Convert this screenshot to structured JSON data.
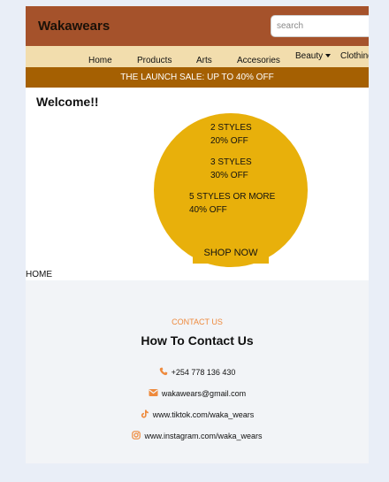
{
  "header": {
    "brand": "Wakawears",
    "search_placeholder": "search"
  },
  "nav": {
    "items": [
      "Home",
      "Products",
      "Arts",
      "Accesories"
    ],
    "dropdown_label": "Beauty",
    "last_label": "Clothing"
  },
  "banner": {
    "text": "THE LAUNCH SALE: UP TO 40% OFF"
  },
  "promo": {
    "welcome": "Welcome!!",
    "offers": [
      {
        "line1": "2 STYLES",
        "line2": "20% OFF"
      },
      {
        "line1": "3 STYLES",
        "line2": "30% OFF"
      },
      {
        "line1": "5 STYLES OR MORE",
        "line2": "40% OFF"
      }
    ],
    "cta_label": "SHOP NOW"
  },
  "breadcrumb": "HOME",
  "contact": {
    "eyebrow": "CONTACT US",
    "title": "How To Contact Us",
    "phone": "+254 778 136 430",
    "email": "wakawears@gmail.com",
    "tiktok": "www.tiktok.com/waka_wears",
    "instagram": "www.instagram.com/waka_wears",
    "icon_color": "#ee8a3d"
  },
  "colors": {
    "header": "#a5522b",
    "nav": "#f2ddad",
    "banner": "#a56002",
    "promo_circle": "#e8b00b",
    "contact_bg": "#f2f4f7",
    "page_bg": "#e9eef7"
  }
}
